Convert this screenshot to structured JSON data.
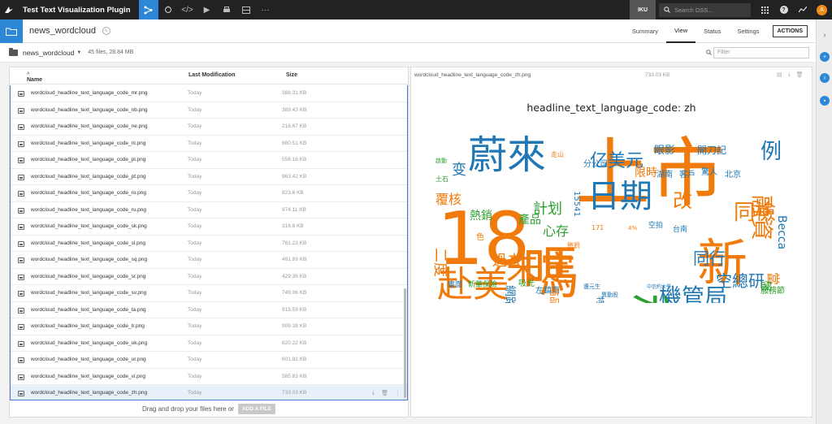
{
  "topnav": {
    "app_title": "Test Text Visualization Plugin",
    "instance_label": "IKU",
    "search_placeholder": "Search DSS...",
    "avatar_initial": "A"
  },
  "object": {
    "name": "news_wordcloud",
    "tabs": [
      "Summary",
      "View",
      "Status",
      "Settings"
    ],
    "active_tab": "View",
    "actions_label": "ACTIONS"
  },
  "folder": {
    "name": "news_wordcloud",
    "stats": "45 files, 28.84 MB",
    "filter_placeholder": "Filter"
  },
  "file_list": {
    "columns": {
      "name": "Name",
      "last_modification": "Last Modification",
      "size": "Size"
    },
    "rows": [
      {
        "name": "wordcloud_headline_text_language_code_mr.png",
        "modified": "Today",
        "size": "388.31 KB"
      },
      {
        "name": "wordcloud_headline_text_language_code_nb.png",
        "modified": "Today",
        "size": "389.43 KB"
      },
      {
        "name": "wordcloud_headline_text_language_code_ne.png",
        "modified": "Today",
        "size": "218.67 KB"
      },
      {
        "name": "wordcloud_headline_text_language_code_nl.png",
        "modified": "Today",
        "size": "880.51 KB"
      },
      {
        "name": "wordcloud_headline_text_language_code_pl.png",
        "modified": "Today",
        "size": "556.16 KB"
      },
      {
        "name": "wordcloud_headline_text_language_code_pt.png",
        "modified": "Today",
        "size": "963.42 KB"
      },
      {
        "name": "wordcloud_headline_text_language_code_ro.png",
        "modified": "Today",
        "size": "823.6 KB"
      },
      {
        "name": "wordcloud_headline_text_language_code_ru.png",
        "modified": "Today",
        "size": "974.11 KB"
      },
      {
        "name": "wordcloud_headline_text_language_code_sk.png",
        "modified": "Today",
        "size": "316.8 KB"
      },
      {
        "name": "wordcloud_headline_text_language_code_sl.png",
        "modified": "Today",
        "size": "781.23 KB"
      },
      {
        "name": "wordcloud_headline_text_language_code_sq.png",
        "modified": "Today",
        "size": "461.89 KB"
      },
      {
        "name": "wordcloud_headline_text_language_code_sr.png",
        "modified": "Today",
        "size": "429.36 KB"
      },
      {
        "name": "wordcloud_headline_text_language_code_sv.png",
        "modified": "Today",
        "size": "749.06 KB"
      },
      {
        "name": "wordcloud_headline_text_language_code_ta.png",
        "modified": "Today",
        "size": "915.59 KB"
      },
      {
        "name": "wordcloud_headline_text_language_code_tr.png",
        "modified": "Today",
        "size": "909.38 KB"
      },
      {
        "name": "wordcloud_headline_text_language_code_uk.png",
        "modified": "Today",
        "size": "620.22 KB"
      },
      {
        "name": "wordcloud_headline_text_language_code_ur.png",
        "modified": "Today",
        "size": "601.82 KB"
      },
      {
        "name": "wordcloud_headline_text_language_code_vi.png",
        "modified": "Today",
        "size": "585.83 KB"
      },
      {
        "name": "wordcloud_headline_text_language_code_zh.png",
        "modified": "Today",
        "size": "733.03 KB",
        "selected": true
      }
    ],
    "drop_text": "Drag and drop your files here or",
    "add_file_label": "ADD A FILE"
  },
  "preview": {
    "file_name": "wordcloud_headline_text_language_code_zh.png",
    "file_size": "733.03 KB",
    "title": "headline_text_language_code: zh",
    "words": [
      "上市",
      "18",
      "嗎",
      "新",
      "稱",
      "蔚來",
      "赴美",
      "日期",
      "未定",
      "機管局",
      "同檢",
      "融資",
      "例",
      "改",
      "心存",
      "計划",
      "熱銷",
      "產品",
      "網路",
      "過去",
      "二度",
      "覆核",
      "变",
      "亿美元",
      "眼影",
      "開刀記",
      "當",
      "同行",
      "空總研",
      "服務節",
      "盤",
      "Becca",
      "限時",
      "分公司",
      "湖南",
      "客戶",
      "驚人",
      "北京",
      "15541",
      "左鎮南",
      "新華保險",
      "書面",
      "特惠",
      "遭元生",
      "異動股",
      "台南",
      "空拍",
      "171",
      "4%",
      "中信約大學",
      "走山",
      "啟動",
      "土石",
      "色",
      "吸光",
      "懲罰",
      "商品"
    ],
    "colors": {
      "orange": "#f07a0a",
      "blue": "#1f77b4",
      "green": "#2ca02c"
    }
  },
  "colors": {
    "accent": "#2d86d6",
    "topnav": "#222222",
    "selection_border": "#4a7bd0"
  }
}
